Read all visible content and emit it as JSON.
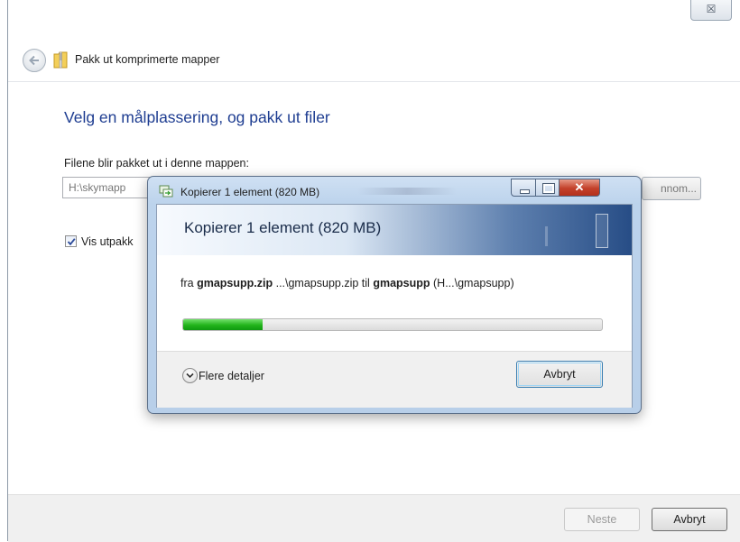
{
  "wizard": {
    "close_glyph": "☒",
    "back_icon": "back-arrow-icon",
    "title_icon": "zip-folder-icon",
    "title": "Pakk ut komprimerte mapper",
    "heading": "Velg en målplassering, og pakk ut filer",
    "field_label": "Filene blir pakket ut i denne mappen:",
    "path_value": "H:\\skymapp",
    "browse_label": "nnom...",
    "show_checkbox": {
      "checked": true,
      "label": "Vis utpakk"
    },
    "next_label": "Neste",
    "cancel_label": "Avbryt"
  },
  "copy_dialog": {
    "title": "Kopierer 1 element (820 MB)",
    "banner_title": "Kopierer 1 element (820 MB)",
    "fra": "fra",
    "source_name": "gmapsupp.zip",
    "source_path": "...\\gmapsupp.zip",
    "til": "til",
    "dest_name": "gmapsupp",
    "dest_path": "(H...\\gmapsupp)",
    "progress": 0.19,
    "details_label": "Flere detaljer",
    "cancel_label": "Avbryt",
    "colors": {
      "progress_green": "#22b31b",
      "close_red": "#c3402a",
      "heading_blue": "#1e3d91"
    }
  }
}
